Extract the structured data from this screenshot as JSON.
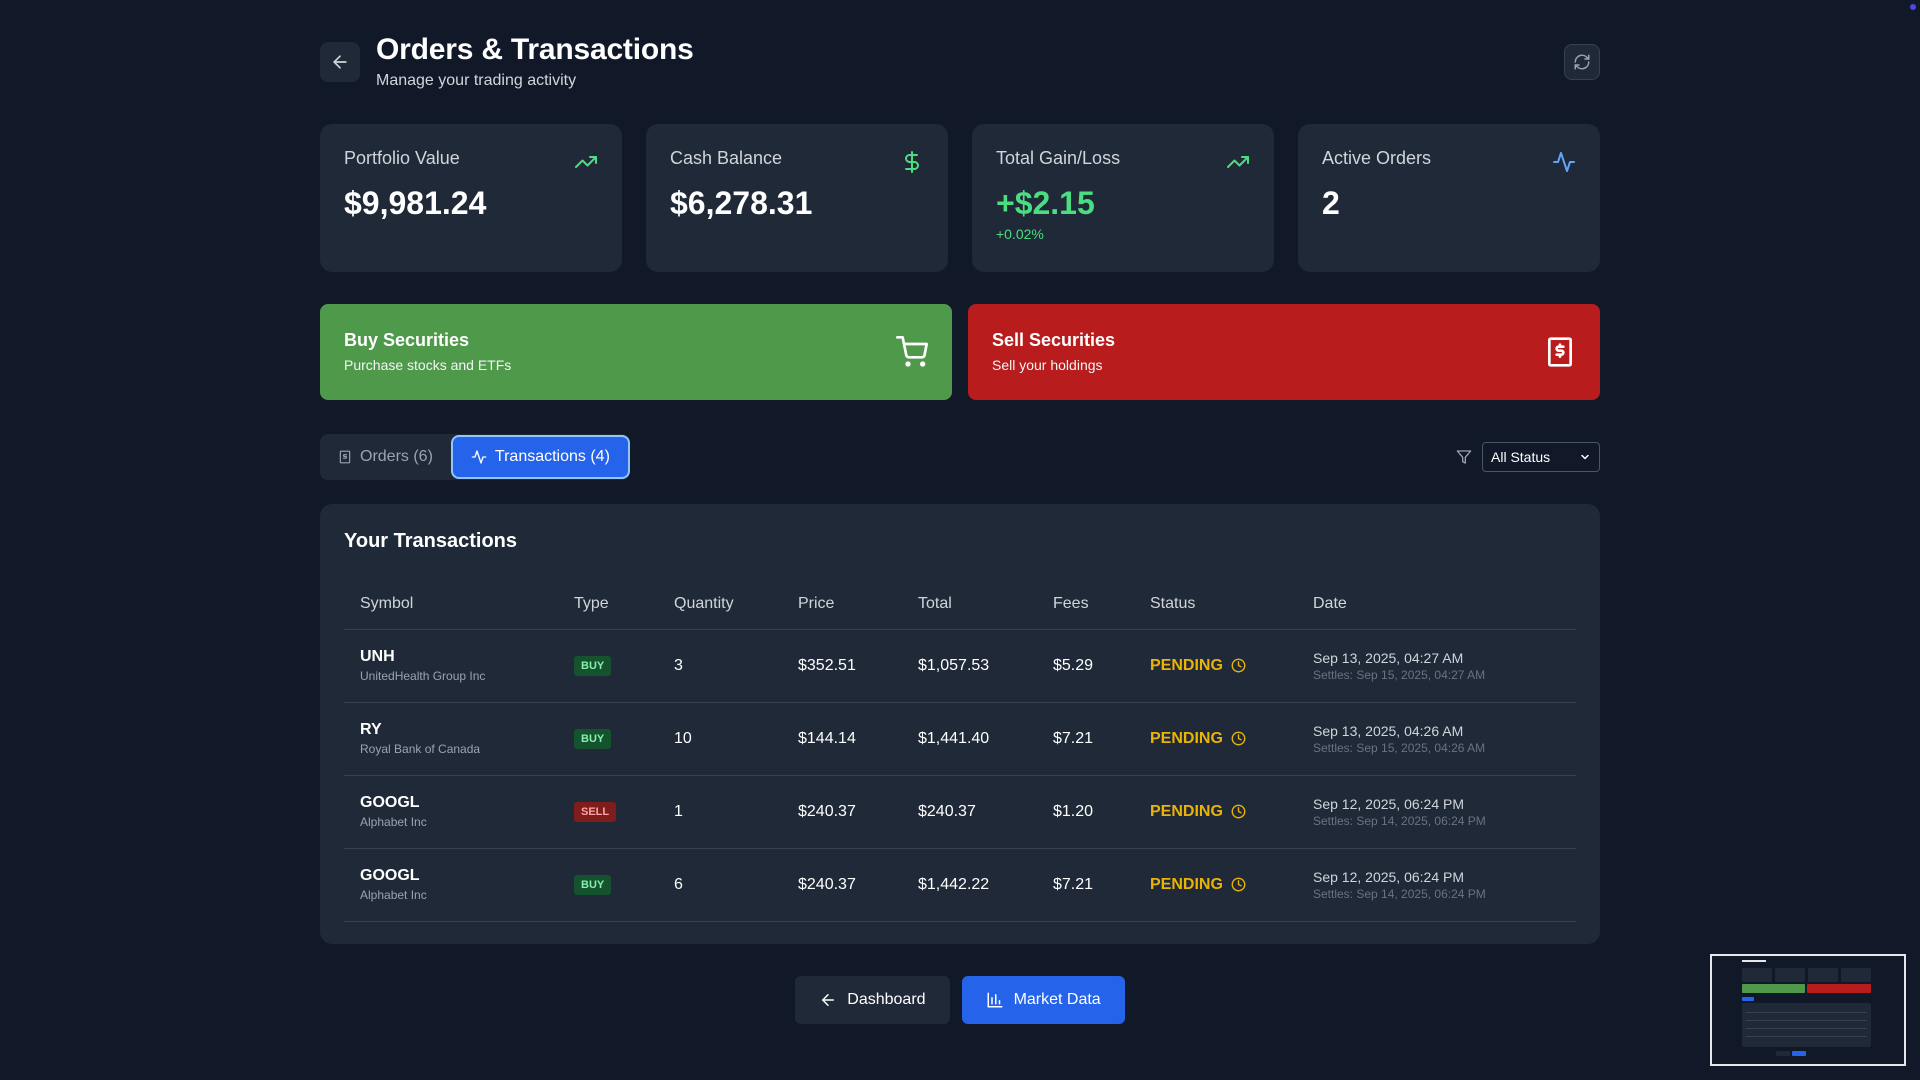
{
  "header": {
    "title": "Orders & Transactions",
    "subtitle": "Manage your trading activity"
  },
  "stats": [
    {
      "label": "Portfolio Value",
      "value": "$9,981.24",
      "icon": "trending-up-icon"
    },
    {
      "label": "Cash Balance",
      "value": "$6,278.31",
      "icon": "dollar-icon"
    },
    {
      "label": "Total Gain/Loss",
      "value": "+$2.15",
      "sub": "+0.02%",
      "icon": "trending-up-icon"
    },
    {
      "label": "Active Orders",
      "value": "2",
      "icon": "activity-icon"
    }
  ],
  "actions": {
    "buy": {
      "title": "Buy Securities",
      "subtitle": "Purchase stocks and ETFs",
      "icon": "cart-icon"
    },
    "sell": {
      "title": "Sell Securities",
      "subtitle": "Sell your holdings",
      "icon": "receipt-dollar-icon"
    }
  },
  "tabs": [
    {
      "label": "Orders (6)",
      "active": false
    },
    {
      "label": "Transactions (4)",
      "active": true
    }
  ],
  "filter": {
    "selected": "All Status"
  },
  "table": {
    "title": "Your Transactions",
    "columns": [
      "Symbol",
      "Type",
      "Quantity",
      "Price",
      "Total",
      "Fees",
      "Status",
      "Date"
    ],
    "rows": [
      {
        "symbol": "UNH",
        "name": "UnitedHealth Group Inc",
        "type": "BUY",
        "quantity": "3",
        "price": "$352.51",
        "total": "$1,057.53",
        "fees": "$5.29",
        "status": "PENDING",
        "date": "Sep 13, 2025, 04:27 AM",
        "settles": "Settles: Sep 15, 2025, 04:27 AM"
      },
      {
        "symbol": "RY",
        "name": "Royal Bank of Canada",
        "type": "BUY",
        "quantity": "10",
        "price": "$144.14",
        "total": "$1,441.40",
        "fees": "$7.21",
        "status": "PENDING",
        "date": "Sep 13, 2025, 04:26 AM",
        "settles": "Settles: Sep 15, 2025, 04:26 AM"
      },
      {
        "symbol": "GOOGL",
        "name": "Alphabet Inc",
        "type": "SELL",
        "quantity": "1",
        "price": "$240.37",
        "total": "$240.37",
        "fees": "$1.20",
        "status": "PENDING",
        "date": "Sep 12, 2025, 06:24 PM",
        "settles": "Settles: Sep 14, 2025, 06:24 PM"
      },
      {
        "symbol": "GOOGL",
        "name": "Alphabet Inc",
        "type": "BUY",
        "quantity": "6",
        "price": "$240.37",
        "total": "$1,442.22",
        "fees": "$7.21",
        "status": "PENDING",
        "date": "Sep 12, 2025, 06:24 PM",
        "settles": "Settles: Sep 14, 2025, 06:24 PM"
      }
    ]
  },
  "bottom": {
    "dashboard_label": "Dashboard",
    "market_label": "Market Data"
  },
  "colors": {
    "background": "#111827",
    "card": "#1f2937",
    "buy": "#4f9a4a",
    "sell": "#b91c1c",
    "accent": "#2563eb",
    "positive": "#4ade80",
    "pending": "#eab308"
  }
}
